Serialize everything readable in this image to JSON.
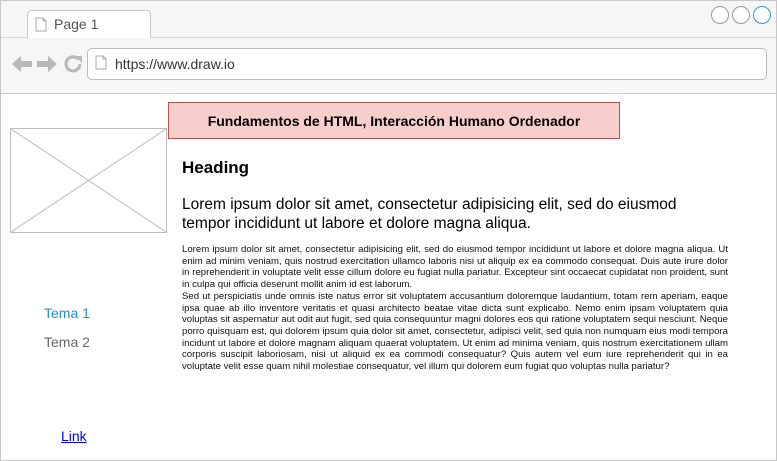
{
  "browser": {
    "tab_title": "Page 1",
    "url": "https://www.draw.io"
  },
  "icons": {
    "back": "arrow-left-icon",
    "forward": "arrow-right-icon",
    "refresh": "refresh-icon",
    "document": "document-icon"
  },
  "page": {
    "banner": "Fundamentos de HTML, Interacción Humano Ordenador",
    "heading": "Heading",
    "lead": "Lorem ipsum dolor sit amet, consectetur adipisicing elit, sed do eiusmod tempor incididunt ut labore et dolore magna aliqua.",
    "paragraphs": [
      "Lorem ipsum dolor sit amet, consectetur adipisicing elit, sed do eiusmod tempor incididunt ut labore et dolore magna aliqua. Ut enim ad minim veniam, quis nostrud exercitation ullamco laboris nisi ut aliquip ex ea commodo consequat. Duis aute irure dolor in reprehenderit in voluptate velit esse cillum dolore eu fugiat nulla pariatur. Excepteur sint occaecat cupidatat non proident, sunt in culpa qui officia deserunt mollit anim id est laborum.",
      "Sed ut perspiciatis unde omnis iste natus error sit voluptatem accusantium doloremque laudantium, totam rem aperiam, eaque ipsa quae ab illo inventore veritatis et quasi architecto beatae vitae dicta sunt explicabo. Nemo enim ipsam voluptatem quia voluptas sit aspernatur aut odit aut fugit, sed quia consequuntur magni dolores eos qui ratione voluptatem sequi nesciunt. Neque porro quisquam est, qui dolorem ipsum quia dolor sit amet, consectetur, adipisci velit, sed quia non numquam eius modi tempora incidunt ut labore et dolore magnam aliquam quaerat voluptatem. Ut enim ad minima veniam, quis nostrum exercitationem ullam corporis suscipit laboriosam, nisi ut aliquid ex ea commodi consequatur? Quis autem vel eum iure reprehenderit qui in ea voluptate velit esse quam nihil molestiae consequatur, vel illum qui dolorem eum fugiat quo voluptas nulla pariatur?"
    ]
  },
  "sidebar": {
    "items": [
      {
        "label": "Tema 1",
        "color": "#1f8fd0"
      },
      {
        "label": "Tema 2",
        "color": "#666666"
      }
    ],
    "link": "Link"
  },
  "colors": {
    "banner_fill": "#f8cecc",
    "banner_border": "#b85450",
    "active_topic": "#1f8fd0",
    "link": "#0000ee"
  }
}
